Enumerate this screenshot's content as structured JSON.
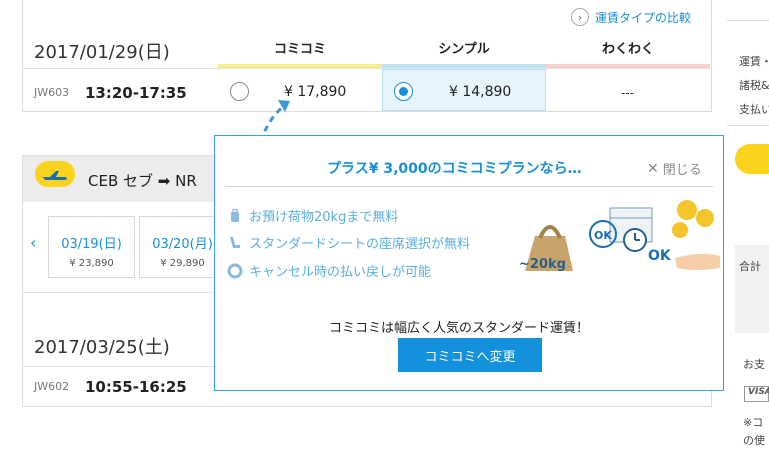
{
  "flight1": {
    "compare_link": "運賃タイプの比較",
    "date": "2017/01/29(日)",
    "fare_columns": [
      {
        "label": "コミコミ",
        "color": "#f6ef8a"
      },
      {
        "label": "シンプル",
        "color": "#bfe2f5"
      },
      {
        "label": "わくわく",
        "color": "#f7cfcf"
      }
    ],
    "flight_no": "JW603",
    "time": "13:20-17:35",
    "price_komikomi": "¥ 17,890",
    "price_simple": "¥ 14,890",
    "price_wakuwaku": "---"
  },
  "flight2": {
    "route": "CEB セブ ➡ NR",
    "dates": [
      {
        "date": "03/19(日)",
        "price": "¥ 23,890"
      },
      {
        "date": "03/20(月)",
        "price": "¥ 29,890"
      }
    ],
    "date": "2017/03/25(土)",
    "flight_no": "JW602",
    "time": "10:55-16:25"
  },
  "sidebar": {
    "line1": "運賃・",
    "line2": "諸税&",
    "line3": "支払い",
    "total": "合計",
    "payment": "お支",
    "card": "VISA",
    "note1": "※コ",
    "note2": "の使"
  },
  "popup": {
    "title": "プラス¥ 3,000のコミコミプランなら…",
    "close_label": "閉じる",
    "features": [
      "お預け荷物20kgまで無料",
      "スタンダードシートの座席選択が無料",
      "キャンセル時の払い戻しが可能"
    ],
    "illus_weight": "~20kg",
    "illus_ok1": "OK",
    "illus_ok2": "OK",
    "message": "コミコミは幅広く人気のスタンダード運賃！",
    "cta_label": "コミコミへ変更"
  },
  "colors": {
    "accent": "#1a8fd6",
    "brand_yellow": "#fbd31d",
    "cta": "#1391dc"
  }
}
